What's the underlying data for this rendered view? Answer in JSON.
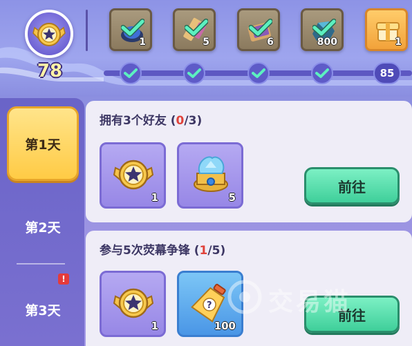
{
  "progress": {
    "current_level": "78",
    "final_node": "85",
    "rewards": [
      {
        "icon": "blue-gem-icon",
        "count": "1",
        "claimed": true
      },
      {
        "icon": "scroll-ticket-icon",
        "count": "5",
        "claimed": true
      },
      {
        "icon": "card-pack-icon",
        "count": "6",
        "claimed": true
      },
      {
        "icon": "crystal-ore-icon",
        "count": "800",
        "claimed": true
      },
      {
        "icon": "golden-crate-icon",
        "count": "1",
        "claimed": false
      }
    ]
  },
  "days": [
    {
      "label": "第1天",
      "active": true
    },
    {
      "label": "第2天",
      "active": false
    },
    {
      "label": "第3天",
      "active": false,
      "alert": "!"
    }
  ],
  "tasks": [
    {
      "title": "拥有3个好友",
      "progress_current": "0",
      "progress_total": "3",
      "rewards": [
        {
          "icon": "star-medal-icon",
          "count": "1"
        },
        {
          "icon": "crystal-chest-icon",
          "count": "5"
        }
      ],
      "button": "前往"
    },
    {
      "title": "参与5次荧幕争锋",
      "progress_current": "1",
      "progress_total": "5",
      "rewards": [
        {
          "icon": "star-medal-icon",
          "count": "1"
        },
        {
          "icon": "mystery-bottle-icon",
          "count": "100"
        }
      ],
      "button": "前往"
    }
  ],
  "watermark": "交易猫",
  "colors": {
    "active_tab": "#ffcb45",
    "go_button": "#3fcf9a",
    "progress_highlight": "#e0433b",
    "check": "#3fd9a8"
  }
}
